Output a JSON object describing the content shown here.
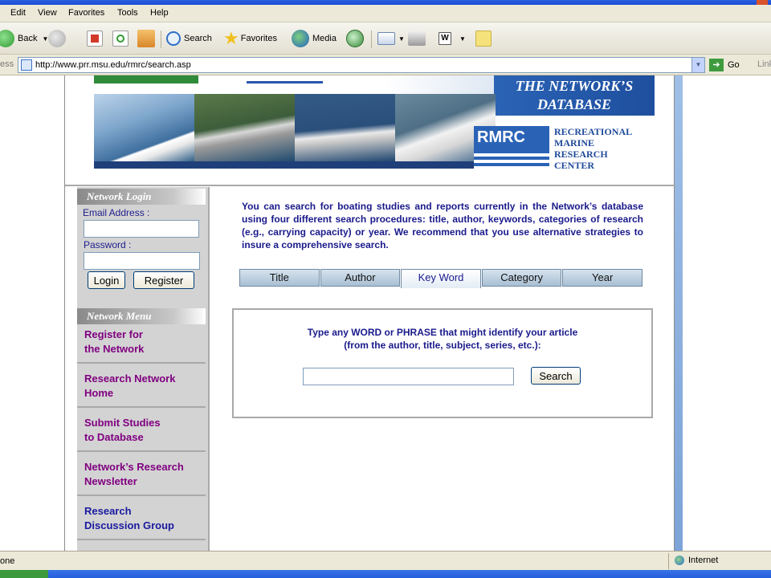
{
  "browser": {
    "menu": [
      "Edit",
      "View",
      "Favorites",
      "Tools",
      "Help"
    ],
    "toolbar": {
      "back": "Back",
      "search": "Search",
      "favorites": "Favorites",
      "media": "Media"
    },
    "address_label": "ess",
    "url": "http://www.prr.msu.edu/rmrc/search.asp",
    "go": "Go",
    "links": "Link",
    "status_text": "one",
    "zone": "Internet"
  },
  "banner": {
    "title_line1": "THE NETWORK’S",
    "title_line2": "DATABASE",
    "logo_text": "RMRC",
    "center_line1": "RECREATIONAL",
    "center_line2": "MARINE",
    "center_line3": "RESEARCH",
    "center_line4": "CENTER"
  },
  "login": {
    "title": "Network Login",
    "email_label": "Email Address :",
    "email_value": "",
    "password_label": "Password :",
    "password_value": "",
    "login_button": "Login",
    "register_button": "Register"
  },
  "menu": {
    "title": "Network Menu",
    "items": [
      {
        "line1": "Register for",
        "line2": "the Network"
      },
      {
        "line1": "Research Network",
        "line2": "Home"
      },
      {
        "line1": "Submit Studies",
        "line2": "to Database"
      },
      {
        "line1": "Network’s Research",
        "line2": "Newsletter"
      },
      {
        "line1": "Research",
        "line2": "Discussion Group"
      }
    ]
  },
  "main": {
    "intro": "You can search for boating studies and reports currently in the Network’s database using four different search procedures: title, author, keywords, categories of research (e.g., carrying capacity) or year. We recommend that you use alternative strategies to insure a comprehensive search.",
    "tabs": [
      "Title",
      "Author",
      "Key Word",
      "Category",
      "Year"
    ],
    "active_tab": "Key Word",
    "prompt_line1": "Type any WORD or PHRASE that might identify your article",
    "prompt_line2": "(from the author, title, subject, series, etc.):",
    "keyword_value": "",
    "search_button": "Search"
  }
}
